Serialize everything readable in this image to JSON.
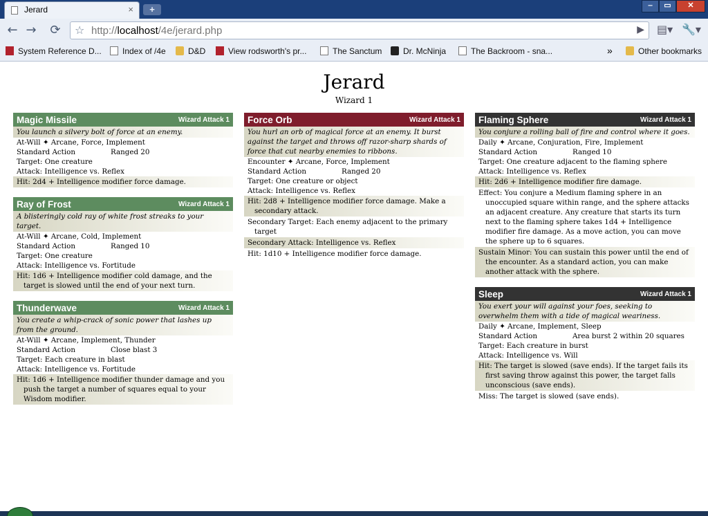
{
  "browser": {
    "tab_title": "Jerard",
    "tab_close": "×",
    "newtab": "+",
    "window_buttons": {
      "min": "‒",
      "max": "▭",
      "close": "✕"
    },
    "nav": {
      "back": "←",
      "forward": "→",
      "reload": "⟳"
    },
    "url_prefix": "http://",
    "url_host": "localhost",
    "url_path": "/4e/jerard.php",
    "star": "☆",
    "go": "▶",
    "page_menu": "▤▾",
    "wrench_menu": "🔧▾"
  },
  "bookmarks": [
    {
      "label": "System Reference D...",
      "icon": "red-book-icon"
    },
    {
      "label": "Index of /4e",
      "icon": "page-icon"
    },
    {
      "label": "D&D",
      "icon": "folder-icon"
    },
    {
      "label": "View rodsworth's pr...",
      "icon": "k-logo-icon"
    },
    {
      "label": "The Sanctum",
      "icon": "page-icon"
    },
    {
      "label": "Dr. McNinja",
      "icon": "ninja-icon"
    },
    {
      "label": "The Backroom - sna...",
      "icon": "page-icon"
    }
  ],
  "bookmarks_overflow": "»",
  "other_bookmarks": "Other bookmarks",
  "page": {
    "title": "Jerard",
    "subtitle": "Wizard 1"
  },
  "powers": {
    "magic_missile": {
      "name": "Magic Missile",
      "class": "Wizard Attack 1",
      "flavor": "You launch a silvery bolt of force at an enemy.",
      "keywords": "At-Will ✦ Arcane, Force, Implement",
      "action": "Standard Action",
      "range": "Ranged 20",
      "target": "Target: One creature",
      "attack": "Attack: Intelligence vs. Reflex",
      "hit": "Hit: 2d4 + Intelligence modifier force damage."
    },
    "ray_of_frost": {
      "name": "Ray of Frost",
      "class": "Wizard Attack 1",
      "flavor": "A blisteringly cold ray of white frost streaks to your target.",
      "keywords": "At-Will ✦ Arcane, Cold, Implement",
      "action": "Standard Action",
      "range": "Ranged 10",
      "target": "Target: One creature",
      "attack": "Attack: Intelligence vs. Fortitude",
      "hit": "Hit: 1d6 + Intelligence modifier cold damage, and the target is slowed until the end of your next turn."
    },
    "thunderwave": {
      "name": "Thunderwave",
      "class": "Wizard Attack 1",
      "flavor": "You create a whip-crack of sonic power that lashes up from the ground.",
      "keywords": "At-Will ✦ Arcane, Implement, Thunder",
      "action": "Standard Action",
      "range": "Close blast 3",
      "target": "Target: Each creature in blast",
      "attack": "Attack: Intelligence vs. Fortitude",
      "hit": "Hit: 1d6 + Intelligence modifier thunder damage and you push the target a number of squares equal to your Wisdom modifier."
    },
    "force_orb": {
      "name": "Force Orb",
      "class": "Wizard Attack 1",
      "flavor": "You hurl an orb of magical force at an enemy. It burst against the target and throws off razor-sharp shards of force that cut nearby enemies to ribbons.",
      "keywords": "Encounter ✦ Arcane, Force, Implement",
      "action": "Standard Action",
      "range": "Ranged 20",
      "target": "Target: One creature or object",
      "attack": "Attack: Intelligence vs. Reflex",
      "hit": "Hit: 2d8 + Intelligence modifier force damage. Make a secondary attack.",
      "secondary_target": "Secondary Target: Each enemy adjacent to the primary target",
      "secondary_attack": "Secondary Attack: Intelligence vs. Reflex",
      "secondary_hit": "Hit: 1d10 + Intelligence modifier force damage."
    },
    "flaming_sphere": {
      "name": "Flaming Sphere",
      "class": "Wizard Attack 1",
      "flavor": "You conjure a rolling ball of fire and control where it goes.",
      "keywords": "Daily ✦ Arcane, Conjuration, Fire, Implement",
      "action": "Standard Action",
      "range": "Ranged 10",
      "target": "Target: One creature adjacent to the flaming sphere",
      "attack": "Attack: Intelligence vs. Reflex",
      "hit": "Hit: 2d6 + Intelligence modifier fire damage.",
      "effect": "Effect: You conjure a Medium flaming sphere in an unoccupied square within range, and the sphere attacks an adjacent creature. Any creature that starts its turn next to the flaming sphere takes 1d4 + Intelligence modifier fire damage. As a move action, you can move the sphere up to 6 squares.",
      "sustain": "Sustain Minor: You can sustain this power until the end of the encounter. As a standard action, you can make another attack with the sphere."
    },
    "sleep": {
      "name": "Sleep",
      "class": "Wizard Attack 1",
      "flavor": "You exert your will against your foes, seeking to overwhelm them with a tide of magical weariness.",
      "keywords": "Daily ✦ Arcane, Implement, Sleep",
      "action": "Standard Action",
      "range": "Area burst 2 within 20 squares",
      "target": "Target: Each creature in burst",
      "attack": "Attack: Intelligence vs. Will",
      "hit": "Hit: The target is slowed (save ends). If the target fails its first saving throw against this power, the target falls unconscious (save ends).",
      "miss": "Miss: The target is slowed (save ends)."
    }
  },
  "colors": {
    "at_will_header": "#5d8c5f",
    "encounter_header": "#7f1d2c",
    "daily_header": "#333333"
  }
}
